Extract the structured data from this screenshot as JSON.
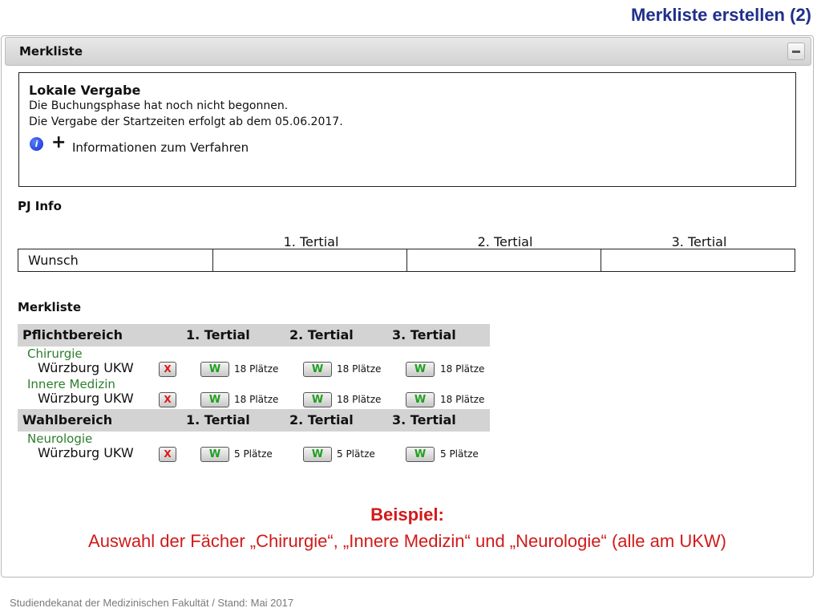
{
  "slide_title": "Merkliste erstellen (2)",
  "panel": {
    "title": "Merkliste"
  },
  "info": {
    "heading": "Lokale Vergabe",
    "line1": "Die Buchungsphase hat noch nicht begonnen.",
    "line2": "Die Vergabe der Startzeiten erfolgt ab dem 05.06.2017.",
    "icon_glyph": "i",
    "plus_glyph": "+",
    "link": "Informationen zum Verfahren"
  },
  "pj_info": {
    "heading": "PJ Info",
    "columns": [
      "1. Tertial",
      "2. Tertial",
      "3. Tertial"
    ],
    "row_label": "Wunsch"
  },
  "merkliste": {
    "heading": "Merkliste",
    "x_label": "X",
    "w_label": "W",
    "sections": [
      {
        "title": "Pflichtbereich",
        "columns": [
          "1. Tertial",
          "2. Tertial",
          "3. Tertial"
        ],
        "rows": [
          {
            "subject": "Chirurgie",
            "location": "Würzburg UKW",
            "places": [
              "18 Plätze",
              "18 Plätze",
              "18 Plätze"
            ]
          },
          {
            "subject": "Innere Medizin",
            "location": "Würzburg UKW",
            "places": [
              "18 Plätze",
              "18 Plätze",
              "18 Plätze"
            ]
          }
        ]
      },
      {
        "title": "Wahlbereich",
        "columns": [
          "1. Tertial",
          "2. Tertial",
          "3. Tertial"
        ],
        "rows": [
          {
            "subject": "Neurologie",
            "location": "Würzburg UKW",
            "places": [
              "5 Plätze",
              "5 Plätze",
              "5 Plätze"
            ]
          }
        ]
      }
    ]
  },
  "caption": {
    "title": "Beispiel:",
    "text": "Auswahl der Fächer „Chirurgie“, „Innere Medizin“ und „Neurologie“ (alle am UKW)"
  },
  "footer": "Studiendekanat der Medizinischen Fakultät / Stand: Mai 2017",
  "colors": {
    "title_blue": "#1f2f8c",
    "caption_red": "#d11a1a",
    "subject_green": "#2d7d2d",
    "w_green": "#1fa01f",
    "x_red": "#e01414"
  }
}
